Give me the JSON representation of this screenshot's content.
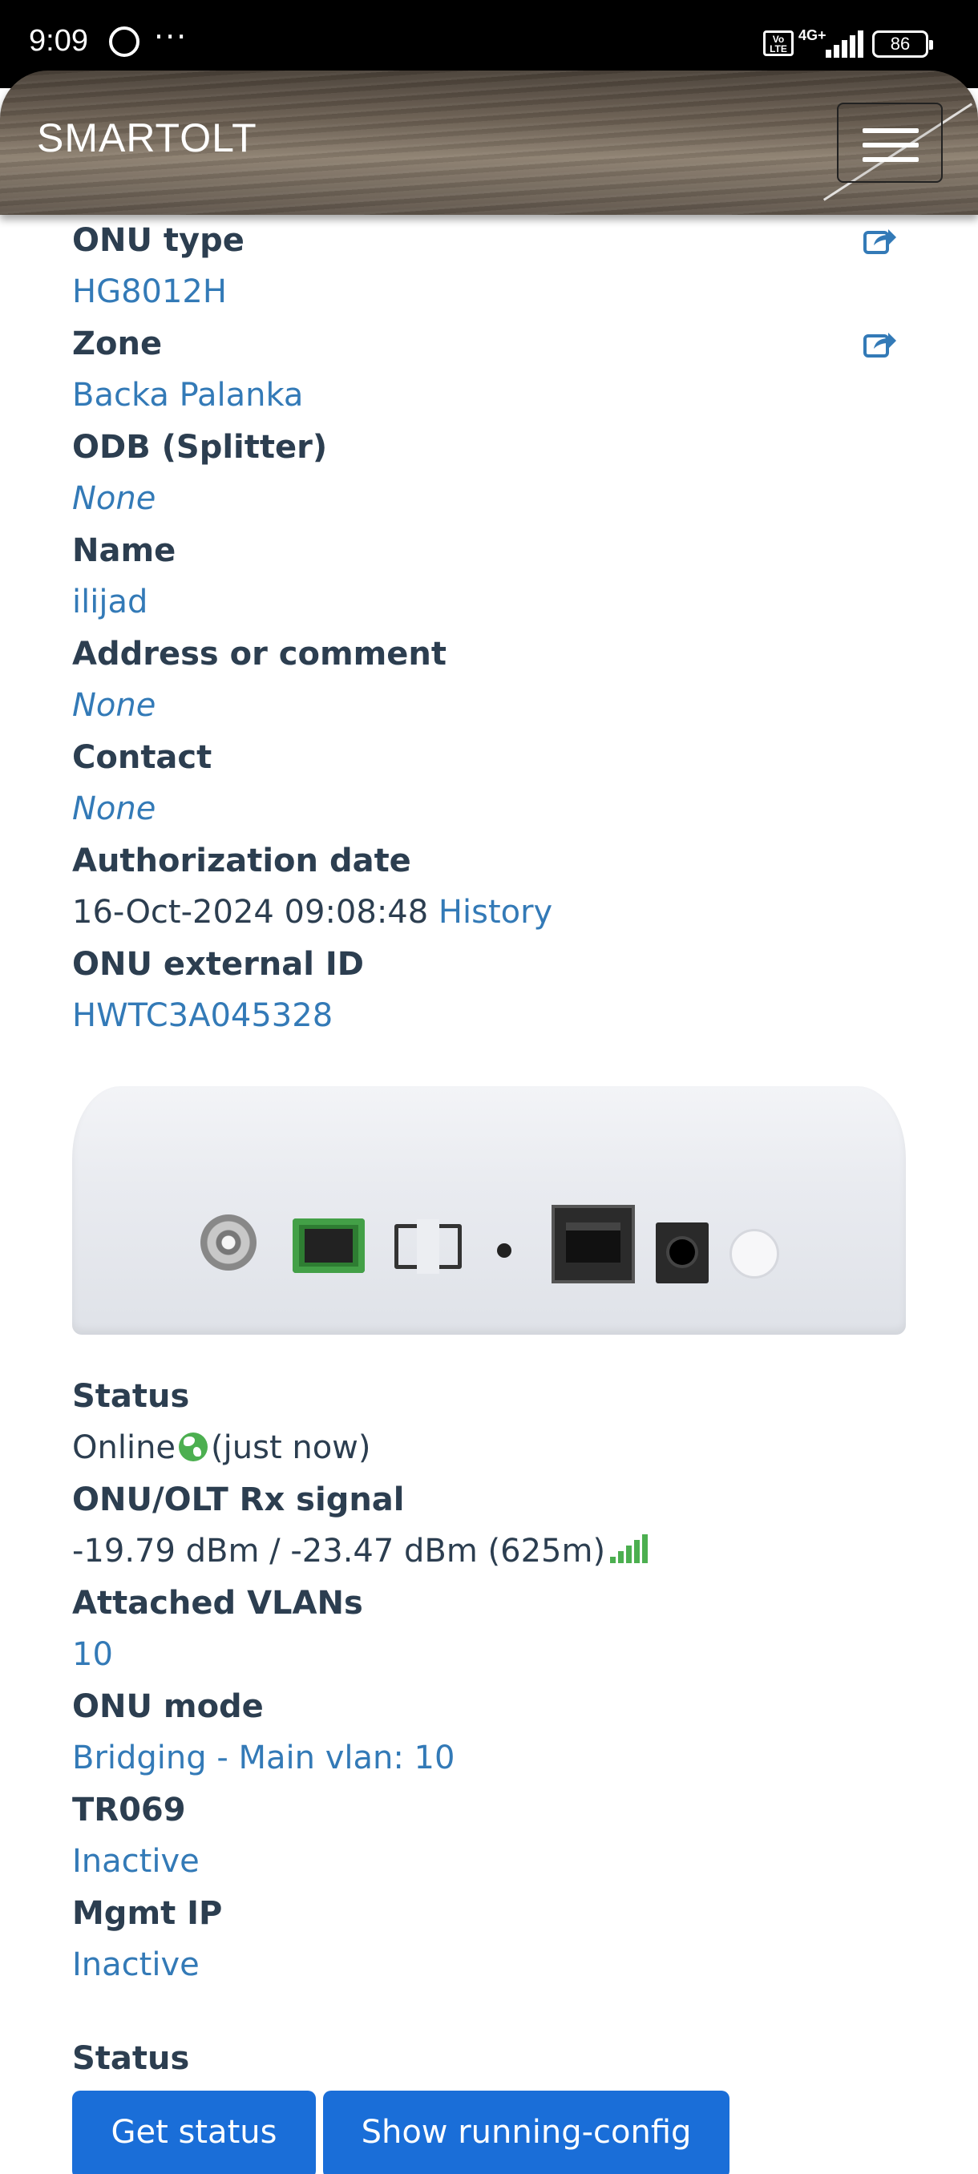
{
  "status_bar": {
    "time": "9:09",
    "dots": "···",
    "volte": "Vo LTE",
    "network": "4G+",
    "battery": "86"
  },
  "navbar": {
    "brand": "SMARTOLT",
    "menu_icon": "hamburger-icon"
  },
  "details": {
    "onu_type_label": "ONU type",
    "onu_type_value": "HG8012H",
    "zone_label": "Zone",
    "zone_value": "Backa Palanka",
    "odb_label": "ODB (Splitter)",
    "odb_value": "None",
    "name_label": "Name",
    "name_value": "ilijad",
    "address_label": "Address or comment",
    "address_value": "None",
    "contact_label": "Contact",
    "contact_value": "None",
    "auth_date_label": "Authorization date",
    "auth_date_value": "16-Oct-2024 09:08:48",
    "auth_history_link": "History",
    "external_id_label": "ONU external ID",
    "external_id_value": "HWTC3A045328"
  },
  "status": {
    "status_label": "Status",
    "status_value": "Online",
    "status_time": "(just now)",
    "rx_label": "ONU/OLT Rx signal",
    "rx_value": "-19.79 dBm / -23.47 dBm (625m)",
    "vlans_label": "Attached VLANs",
    "vlans_value": "10",
    "mode_label": "ONU mode",
    "mode_value": "Bridging - Main vlan: 10",
    "tr069_label": "TR069",
    "tr069_value": "Inactive",
    "mgmt_label": "Mgmt IP",
    "mgmt_value": "Inactive"
  },
  "actions": {
    "heading": "Status",
    "get_status": "Get status",
    "show_config": "Show running-config"
  },
  "colors": {
    "link": "#337ab7",
    "label": "#2c3e50",
    "online": "#4caf50",
    "button": "#1a6ed8"
  }
}
